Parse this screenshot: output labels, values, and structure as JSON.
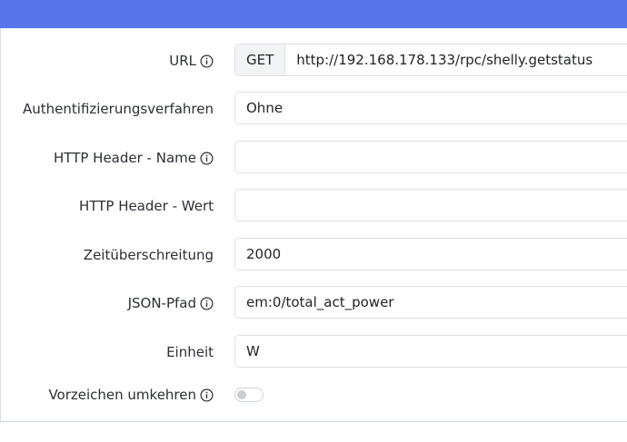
{
  "form": {
    "url": {
      "label": "URL",
      "method": "GET",
      "value": "http://192.168.178.133/rpc/shelly.getstatus"
    },
    "auth": {
      "label": "Authentifizierungsverfahren",
      "value": "Ohne"
    },
    "header_name": {
      "label": "HTTP Header - Name",
      "value": ""
    },
    "header_value": {
      "label": "HTTP Header - Wert",
      "value": ""
    },
    "timeout": {
      "label": "Zeitüberschreitung",
      "value": "2000"
    },
    "json_path": {
      "label": "JSON-Pfad",
      "value": "em:0/total_act_power"
    },
    "unit": {
      "label": "Einheit",
      "value": "W"
    },
    "invert_sign": {
      "label": "Vorzeichen umkehren",
      "checked": false
    }
  },
  "icons": {
    "info": "info-circle-icon"
  },
  "colors": {
    "header": "#5673ea",
    "toggle_off": "#c9ced4"
  }
}
